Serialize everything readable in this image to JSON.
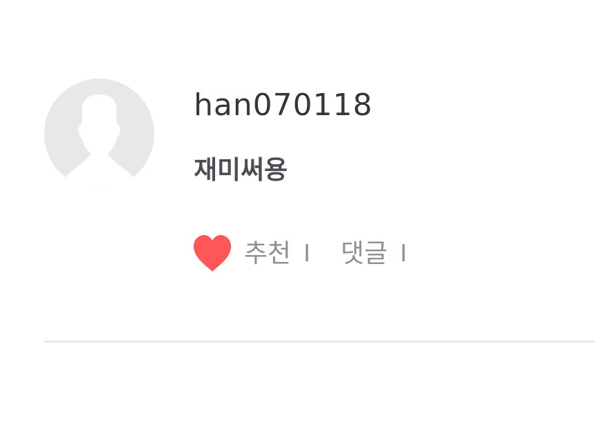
{
  "comment": {
    "username": "han070118",
    "text": "재미써용",
    "actions": {
      "like_label": "추천",
      "like_separator": "I",
      "comments_label": "댓글",
      "comments_separator": "I"
    },
    "icons": {
      "avatar": "default-user-avatar-icon",
      "like": "heart-icon"
    },
    "colors": {
      "heart": "#ff5757",
      "avatar_bg": "#e8e8e8",
      "avatar_silhouette": "#ffffff"
    }
  }
}
